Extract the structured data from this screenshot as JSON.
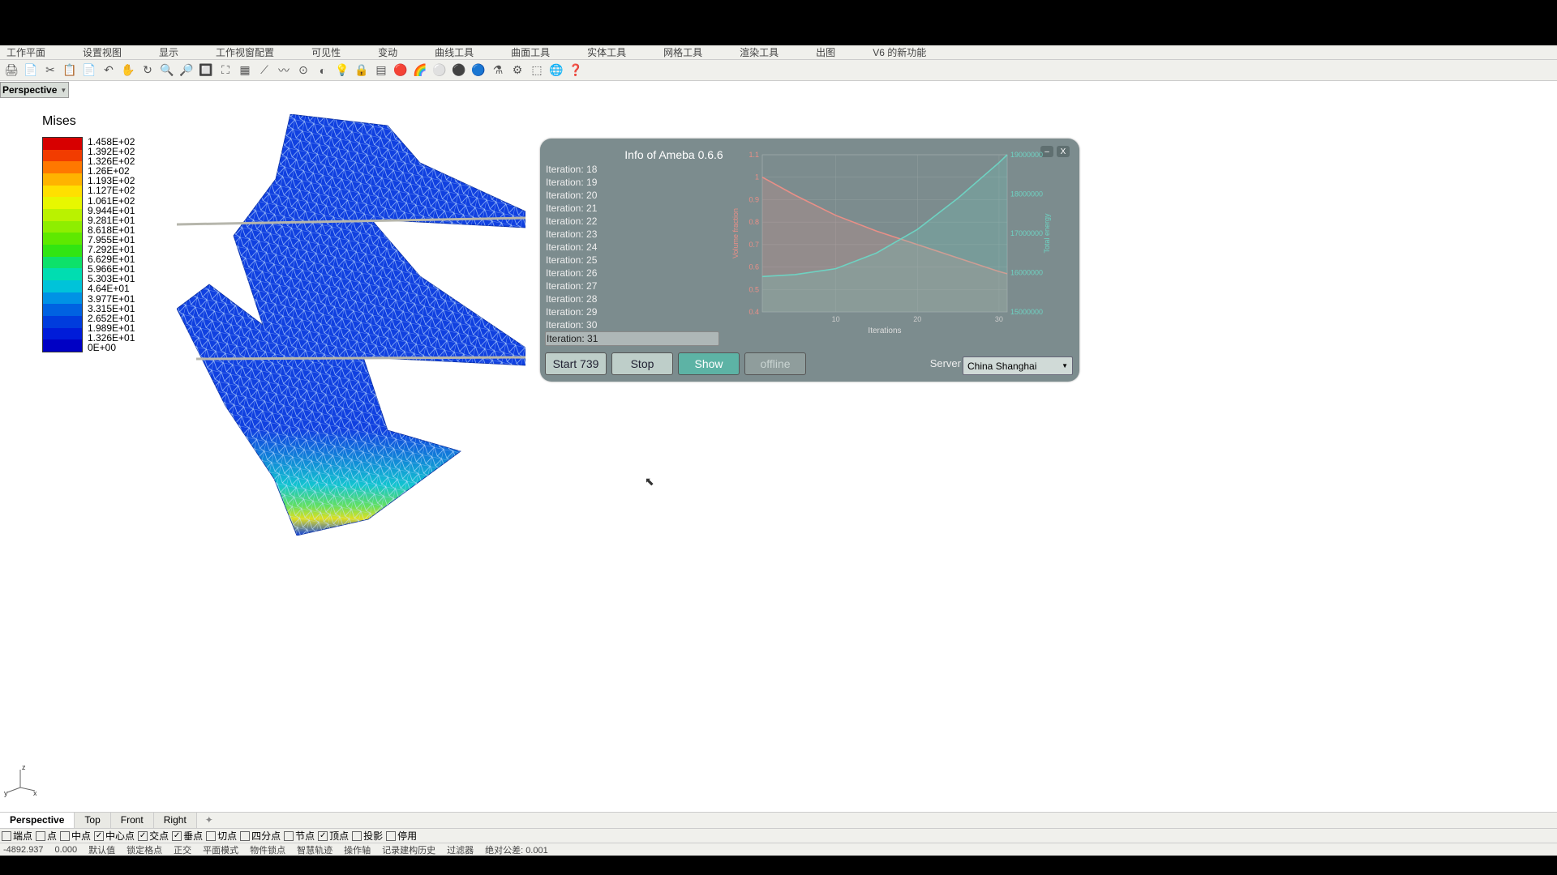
{
  "menu": [
    "工作平面",
    "设置视图",
    "显示",
    "工作视窗配置",
    "可见性",
    "变动",
    "曲线工具",
    "曲面工具",
    "实体工具",
    "网格工具",
    "渲染工具",
    "出图",
    "V6 的新功能"
  ],
  "toolbar_icons": [
    "print-icon",
    "copy-icon",
    "cut-icon",
    "paste-clip-icon",
    "paste-icon",
    "undo-icon",
    "pan-icon",
    "rotate-icon",
    "zoom-icon",
    "zoom-window-icon",
    "zoom-extents-icon",
    "zoom-selected-icon",
    "selection-icon",
    "tangent-icon",
    "curve-icon",
    "circle-icon",
    "arc-icon",
    "lightbulb-icon",
    "lock-icon",
    "layers-icon",
    "material-red-icon",
    "material-rainbow-icon",
    "material-grey-icon",
    "material-dark-icon",
    "material-blue-icon",
    "filter-icon",
    "settings-icon",
    "transform-icon",
    "globe-icon",
    "help-icon"
  ],
  "toolbar_glyphs": [
    "🖨",
    "📄",
    "✂",
    "📋",
    "📄",
    "↶",
    "✋",
    "↻",
    "🔍",
    "🔎",
    "🔲",
    "⛶",
    "▦",
    "⟋",
    "〰",
    "⊙",
    "◐",
    "💡",
    "🔒",
    "▤",
    "🔴",
    "🌈",
    "⚪",
    "⚫",
    "🔵",
    "⚗",
    "⚙",
    "⬚",
    "🌐",
    "❓"
  ],
  "view_selector": {
    "label": "Perspective"
  },
  "legend": {
    "title": "Mises",
    "values": [
      "1.458E+02",
      "1.392E+02",
      "1.326E+02",
      "1.26E+02",
      "1.193E+02",
      "1.127E+02",
      "1.061E+02",
      "9.944E+01",
      "9.281E+01",
      "8.618E+01",
      "7.955E+01",
      "7.292E+01",
      "6.629E+01",
      "5.966E+01",
      "5.303E+01",
      "4.64E+01",
      "3.977E+01",
      "3.315E+01",
      "2.652E+01",
      "1.989E+01",
      "1.326E+01",
      "0E+00"
    ],
    "colors": [
      "#d70000",
      "#f23c00",
      "#ff7800",
      "#ffb300",
      "#ffe000",
      "#e7f700",
      "#baf200",
      "#8eee00",
      "#5ee900",
      "#31e512",
      "#0de16a",
      "#00ddb1",
      "#00c3d9",
      "#0092e5",
      "#0062e1",
      "#003cdd",
      "#001cd9",
      "#0000c4"
    ]
  },
  "axis": {
    "x": "x",
    "y": "y",
    "z": "z"
  },
  "panel": {
    "title": "Info of Ameba 0.6.6",
    "iterations": [
      "Iteration: 18",
      "Iteration: 19",
      "Iteration: 20",
      "Iteration: 21",
      "Iteration: 22",
      "Iteration: 23",
      "Iteration: 24",
      "Iteration: 25",
      "Iteration: 26",
      "Iteration: 27",
      "Iteration: 28",
      "Iteration: 29",
      "Iteration: 30"
    ],
    "current_iter": "Iteration: 31",
    "buttons": {
      "start": "Start 739",
      "stop": "Stop",
      "show": "Show",
      "offline": "offline"
    },
    "server_label": "Server",
    "server_value": "China Shanghai"
  },
  "chart_data": {
    "type": "line",
    "title": "",
    "xlabel": "Iterations",
    "x": [
      1,
      5,
      10,
      15,
      20,
      25,
      30,
      31
    ],
    "x_ticks": [
      10,
      20,
      30
    ],
    "left_axis": {
      "label": "Volume fraction",
      "color": "#e98f87",
      "ylim": [
        0.4,
        1.1
      ],
      "ticks": [
        0.4,
        0.5,
        0.6,
        0.7,
        0.8,
        0.9,
        1,
        1.1
      ]
    },
    "right_axis": {
      "label": "Total energy",
      "color": "#6ed2c2",
      "ylim": [
        15000000,
        19000000
      ],
      "ticks": [
        15000000,
        16000000,
        17000000,
        18000000,
        19000000
      ]
    },
    "series": [
      {
        "name": "Volume fraction",
        "axis": "left",
        "values": [
          1.0,
          0.92,
          0.83,
          0.76,
          0.7,
          0.64,
          0.58,
          0.57
        ],
        "color": "#e98f87"
      },
      {
        "name": "Total energy",
        "axis": "right",
        "values": [
          15900000,
          15950000,
          16100000,
          16500000,
          17100000,
          17900000,
          18800000,
          19000000
        ],
        "color": "#6ed2c2"
      }
    ]
  },
  "view_tabs": [
    "Perspective",
    "Top",
    "Front",
    "Right"
  ],
  "snaps": [
    {
      "label": "端点",
      "checked": false
    },
    {
      "label": "点",
      "checked": false
    },
    {
      "label": "中点",
      "checked": false
    },
    {
      "label": "中心点",
      "checked": true
    },
    {
      "label": "交点",
      "checked": true
    },
    {
      "label": "垂点",
      "checked": true
    },
    {
      "label": "切点",
      "checked": false
    },
    {
      "label": "四分点",
      "checked": false
    },
    {
      "label": "节点",
      "checked": false
    },
    {
      "label": "顶点",
      "checked": true
    },
    {
      "label": "投影",
      "checked": false
    },
    {
      "label": "停用",
      "checked": false
    }
  ],
  "status": {
    "coord": "-4892.937",
    "val": "0.000",
    "def": "默认值",
    "grid": "锁定格点",
    "ortho": "正交",
    "planar": "平面模式",
    "osnap": "物件锁点",
    "smart": "智慧轨迹",
    "gumball": "操作轴",
    "record": "记录建构历史",
    "filter": "过滤器",
    "tol": "绝对公差: 0.001"
  }
}
